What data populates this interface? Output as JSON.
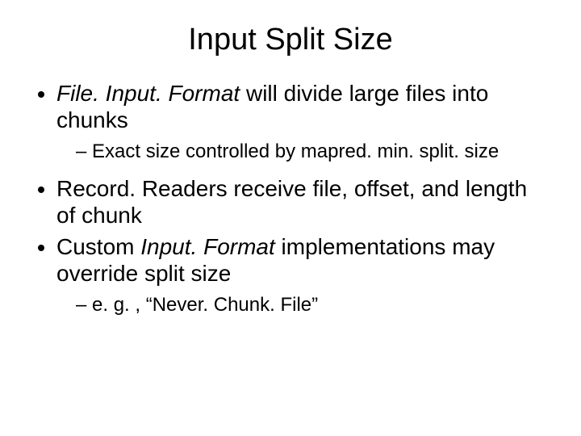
{
  "title": "Input Split Size",
  "bullets": {
    "b1_pre_italic": "File. Input. Format",
    "b1_post": " will divide large files into chunks",
    "b1_sub1": "Exact size controlled by mapred. min. split. size",
    "b2": "Record. Readers receive file, offset, and length of chunk",
    "b3_pre": "Custom ",
    "b3_italic": "Input. Format",
    "b3_post": " implementations may override split size",
    "b3_sub1": "e. g. , “Never. Chunk. File”"
  }
}
